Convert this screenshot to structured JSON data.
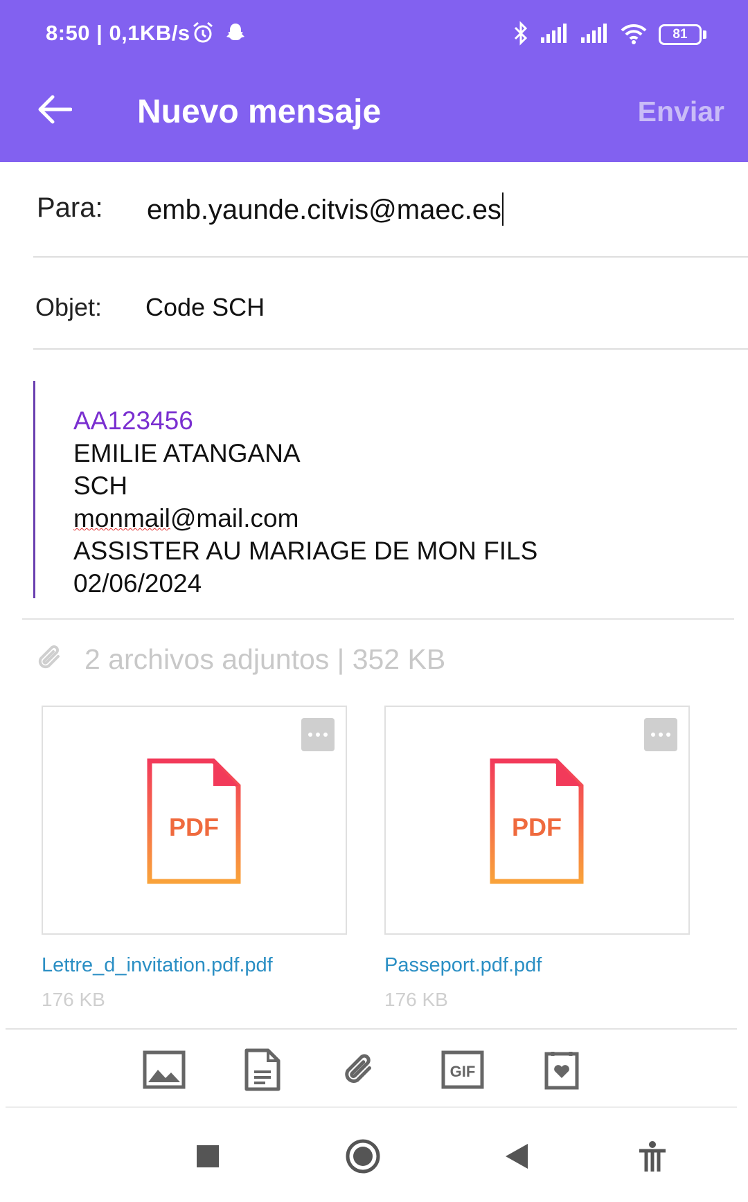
{
  "status_bar": {
    "time_speed": "8:50 | 0,1KB/s",
    "battery": "81"
  },
  "header": {
    "title": "Nuevo mensaje",
    "send_label": "Enviar"
  },
  "to": {
    "label": "Para:",
    "value": "emb.yaunde.citvis@maec.es"
  },
  "subject": {
    "label": "Objet:",
    "value": "Code SCH"
  },
  "body": {
    "line1": "AA123456",
    "line2": "EMILIE ATANGANA",
    "line3": "SCH",
    "line4_misspelled": "monmail",
    "line4_rest": "@mail.com",
    "line5": "ASSISTER AU MARIAGE DE MON FILS",
    "line6": "02/06/2024"
  },
  "attachments": {
    "summary": "2 archivos adjuntos | 352 KB",
    "files": [
      {
        "name": "Lettre_d_invitation.pdf.pdf",
        "size": "176 KB",
        "icon_label": "PDF"
      },
      {
        "name": "Passeport.pdf.pdf",
        "size": "176 KB",
        "icon_label": "PDF"
      }
    ]
  },
  "toolbar_icons": [
    "image-icon",
    "document-icon",
    "attachment-icon",
    "gif-icon",
    "sticker-icon"
  ],
  "colors": {
    "header": "#8261f0",
    "accent_text": "#7a2fd0",
    "link": "#2b8fc4"
  }
}
